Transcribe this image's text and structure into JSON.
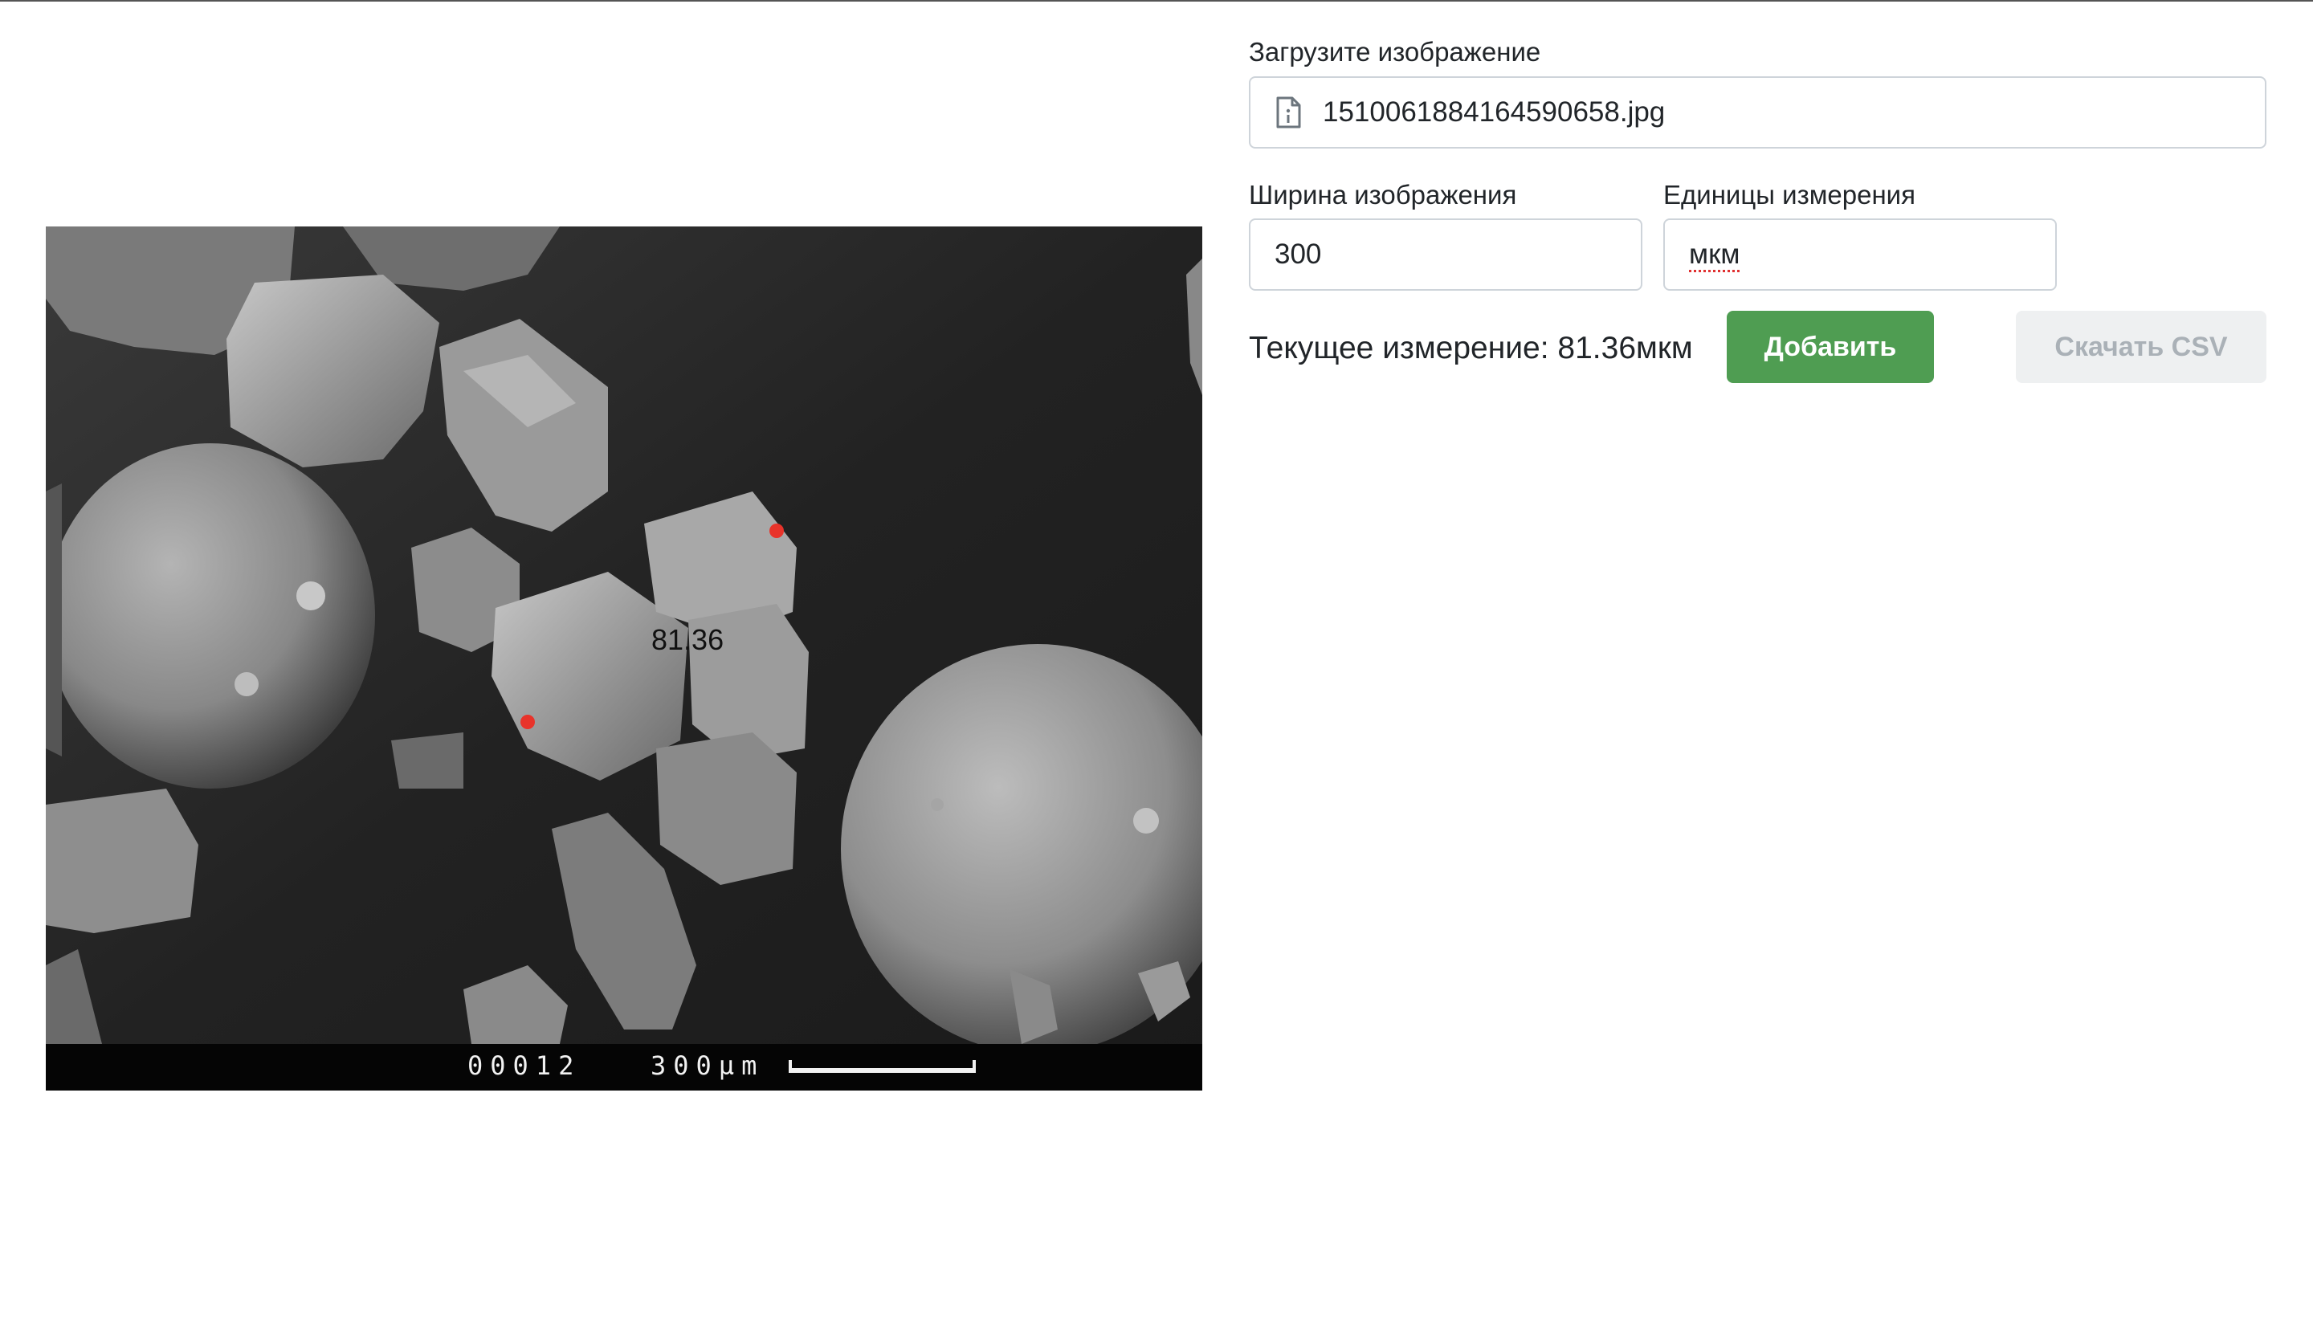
{
  "upload": {
    "label": "Загрузите изображение",
    "file_name": "1510061884164590658.jpg"
  },
  "image_width": {
    "label": "Ширина изображения",
    "value": "300"
  },
  "units": {
    "label": "Единицы измерения",
    "value": "мкм"
  },
  "measurement": {
    "text": "Текущее измерение: 81.36мкм",
    "overlay_label": "81.36"
  },
  "buttons": {
    "add": "Добавить",
    "download_csv": "Скачать CSV"
  },
  "sem_overlay": {
    "code": "00012",
    "scale": "300µm"
  },
  "icons": {
    "file": "file-info-icon"
  },
  "colors": {
    "add_button": "#4f9d52",
    "csv_button_disabled": "#eef0f1",
    "measure_point": "#e8332a"
  }
}
